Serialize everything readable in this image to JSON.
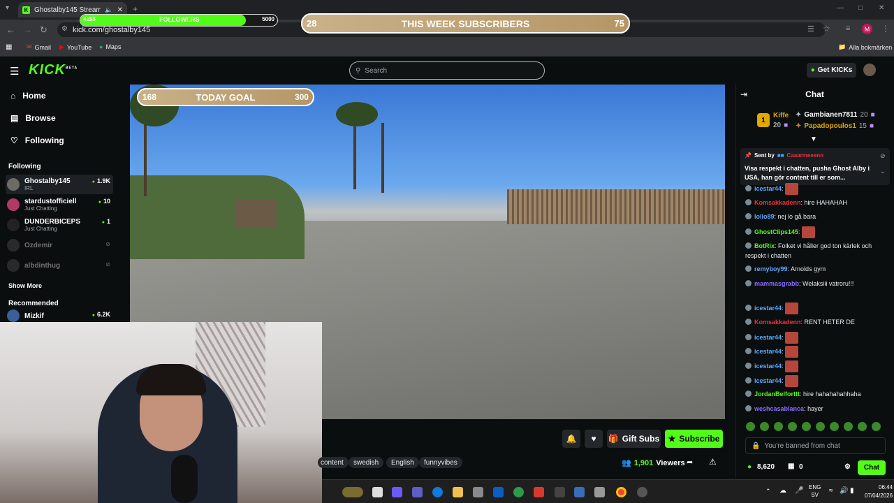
{
  "browser": {
    "tab_title": "Ghostalby145 Stream - Wa",
    "url": "kick.com/ghostalby145",
    "bookmarks": [
      "Gmail",
      "YouTube",
      "Maps"
    ],
    "all_bookmarks": "Alla bokmärken",
    "profile_initial": "M"
  },
  "overlays": {
    "followers": {
      "current": "4198",
      "label": "FOLLOWERS",
      "target": "5000",
      "progress": 0.84
    },
    "week_goal": {
      "current": "28",
      "label": "THIS WEEK SUBSCRIBERS",
      "target": "75"
    },
    "today_goal": {
      "current": "168",
      "label": "TODAY GOAL",
      "target": "300"
    }
  },
  "header": {
    "logo": "KICK",
    "logo_badge": "BETA",
    "search_placeholder": "Search",
    "get_kicks": "Get KICKs"
  },
  "sidebar": {
    "nav": [
      "Home",
      "Browse",
      "Following"
    ],
    "following_heading": "Following",
    "following": [
      {
        "name": "Ghostalby145",
        "category": "IRL",
        "viewers": "1.9K"
      },
      {
        "name": "stardustofficiell",
        "category": "Just Chatting",
        "viewers": "10"
      },
      {
        "name": "DUNDERBICEPS",
        "category": "Just Chatting",
        "viewers": "1"
      },
      {
        "name": "Ozdemir",
        "category": "",
        "viewers": ""
      },
      {
        "name": "albdinthug",
        "category": "",
        "viewers": ""
      }
    ],
    "show_more": "Show More",
    "recommended_heading": "Recommended",
    "recommended": [
      {
        "name": "Mizkif",
        "viewers": "6.2K"
      }
    ]
  },
  "stream": {
    "gift_subs": "Gift Subs",
    "subscribe": "Subscribe",
    "tags": [
      "content",
      "swedish",
      "English",
      "funnyvibes"
    ],
    "viewers_count": "1,901",
    "viewers_label": "Viewers"
  },
  "chat": {
    "title": "Chat",
    "top_gifters": [
      {
        "rank": "1",
        "name": "Kiffe",
        "count": "20"
      },
      {
        "name": "Gambianen7811",
        "count": "20"
      },
      {
        "name": "Papadopoulos1",
        "count": "15"
      }
    ],
    "pinned": {
      "sent_by": "Sent by",
      "sender": "Caaarmeeenn",
      "text": "Visa respekt i chatten, pusha Ghost Alby i USA, han gör content till er som..."
    },
    "messages": [
      {
        "user": "icestar44",
        "text": "",
        "color": "#5aa9ff"
      },
      {
        "user": "Komsakkadenn",
        "text": "hire HAHAHAH",
        "color": "#e8333f"
      },
      {
        "user": "lollo89",
        "text": "nej lo gå bara",
        "color": "#5aa9ff"
      },
      {
        "user": "GhostClips145",
        "text": "",
        "color": "#53fc18"
      },
      {
        "user": "BotRix",
        "text": "Folket vi håller god ton kärlek och respekt i chatten",
        "color": "#53fc18"
      },
      {
        "user": "remyboy99",
        "text": "Arnolds gym",
        "color": "#5aa9ff"
      },
      {
        "user": "mammasgrabb",
        "text": "Welaksiii vatroru!!!",
        "color": "#8a6cff"
      },
      {
        "user": "icestar44",
        "text": "",
        "color": "#5aa9ff"
      },
      {
        "user": "Komsakkadenn",
        "text": "RENT HETER DE",
        "color": "#e8333f"
      },
      {
        "user": "icestar44",
        "text": "",
        "color": "#5aa9ff"
      },
      {
        "user": "icestar44",
        "text": "",
        "color": "#5aa9ff"
      },
      {
        "user": "icestar44",
        "text": "",
        "color": "#5aa9ff"
      },
      {
        "user": "icestar44",
        "text": "",
        "color": "#5aa9ff"
      },
      {
        "user": "JordanBelforttt",
        "text": "hire hahahahahhaha",
        "color": "#53fc18"
      },
      {
        "user": "weshcasablanca",
        "text": "hayer",
        "color": "#8a6cff"
      }
    ],
    "banned_text": "You're banned from chat",
    "points": "8,620",
    "gifts": "0",
    "chat_button": "Chat"
  },
  "taskbar": {
    "lang": "ENG",
    "lang_sub": "SV",
    "time": "06:44",
    "date": "07/04/2026"
  },
  "colors": {
    "kick_green": "#53fc18",
    "bg": "#0b0e0f",
    "goal_gold": "#c9b189"
  }
}
